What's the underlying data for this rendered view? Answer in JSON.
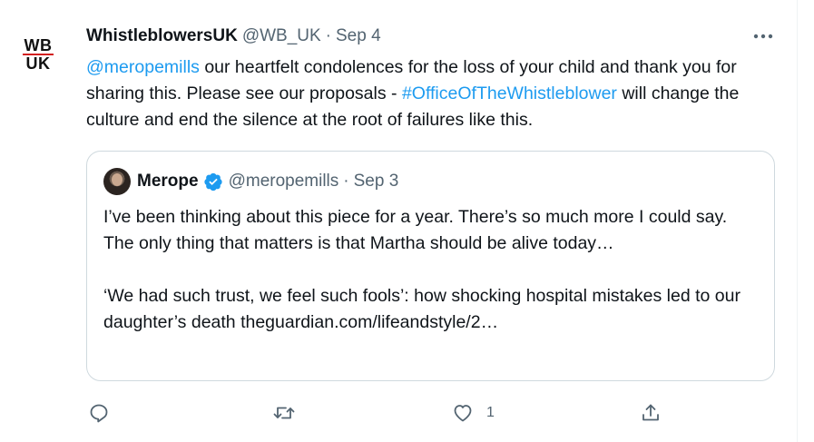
{
  "tweet": {
    "author": {
      "display_name": "WhistleblowersUK",
      "handle": "@WB_UK",
      "avatar_text_line1": "WB",
      "avatar_text_line2": "UK"
    },
    "separator": "·",
    "date": "Sep 4",
    "text": {
      "mention": "@meropemills",
      "part1": " our heartfelt condolences for the loss of your child and thank you for sharing this. Please see our proposals - ",
      "hashtag": "#OfficeOfTheWhistleblower",
      "part2": " will change the culture and end the silence at the root of failures like this."
    },
    "more_icon": "more-horizontal-icon"
  },
  "quoted_tweet": {
    "display_name": "Merope",
    "handle": "@meropemills",
    "separator": "·",
    "date": "Sep 3",
    "verified": true,
    "paragraph1": "I’ve been thinking about this piece for a year. There’s so much more I could say. The only thing that matters is that Martha should be alive today…",
    "paragraph2": "‘We had such trust, we feel such fools’: how shocking hospital mistakes led to our daughter’s death theguardian.com/lifeandstyle/2…"
  },
  "actions": {
    "reply": {
      "icon": "reply-icon",
      "count": ""
    },
    "retweet": {
      "icon": "retweet-icon",
      "count": ""
    },
    "like": {
      "icon": "heart-icon",
      "count": "1"
    },
    "share": {
      "icon": "share-icon",
      "count": ""
    }
  },
  "colors": {
    "link": "#1d9bf0",
    "secondary_text": "#536471",
    "primary_text": "#0f1419",
    "border": "#cfd9de",
    "logo_red": "#d21f1f"
  }
}
